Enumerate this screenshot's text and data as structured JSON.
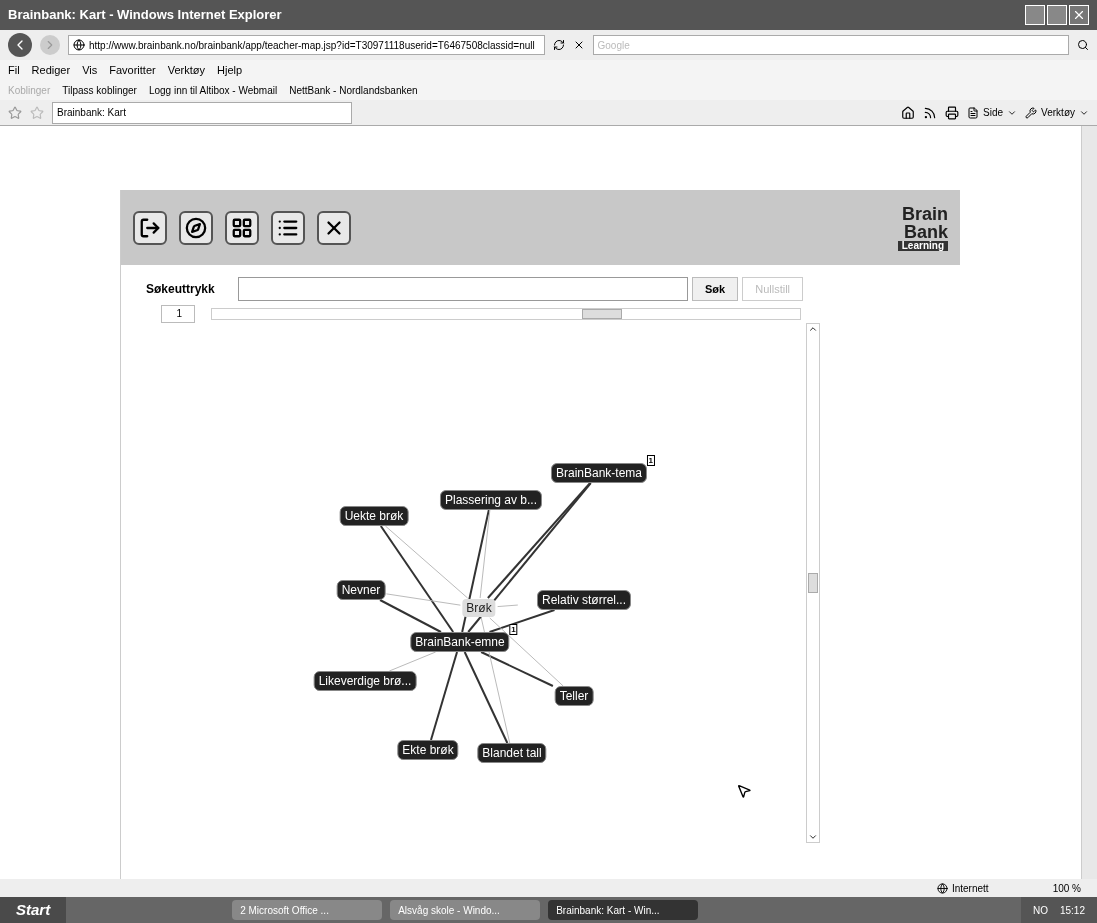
{
  "window": {
    "title": "Brainbank: Kart - Windows Internet Explorer"
  },
  "address_bar": {
    "url": "http://www.brainbank.no/brainbank/app/teacher-map.jsp?id=T30971118userid=T6467508classid=null",
    "search_placeholder": "Google"
  },
  "menu": [
    "Fil",
    "Rediger",
    "Vis",
    "Favoritter",
    "Verktøy",
    "Hjelp"
  ],
  "links_bar": {
    "label": "Koblinger",
    "links": [
      "Tilpass koblinger",
      "Logg inn til Altibox - Webmail",
      "NettBank - Nordlandsbanken"
    ]
  },
  "tab": {
    "title": "Brainbank: Kart"
  },
  "command_bar": [
    "Side",
    "Verktøy"
  ],
  "app": {
    "logo": {
      "line1": "Brain",
      "line2": "Bank",
      "tag": "Learning"
    },
    "search": {
      "label": "Søkeuttrykk",
      "button": "Søk",
      "reset": "Nullstill",
      "reset_disabled": true,
      "depth": "1"
    },
    "map_nodes": [
      {
        "label": "BrainBank-tema",
        "kind": "dark",
        "badge": "1"
      },
      {
        "label": "Plassering av b...",
        "kind": "dark"
      },
      {
        "label": "Uekte brøk",
        "kind": "dark"
      },
      {
        "label": "Nevner",
        "kind": "dark"
      },
      {
        "label": "Brøk",
        "kind": "light"
      },
      {
        "label": "Relativ størrel...",
        "kind": "dark"
      },
      {
        "label": "BrainBank-emne",
        "kind": "dark",
        "badge": "1"
      },
      {
        "label": "Likeverdige brø...",
        "kind": "dark"
      },
      {
        "label": "Teller",
        "kind": "dark"
      },
      {
        "label": "Ekte brøk",
        "kind": "dark"
      },
      {
        "label": "Blandet tall",
        "kind": "dark"
      }
    ]
  },
  "status_bar": {
    "zone": "Internett",
    "zoom": "100 %"
  },
  "taskbar": {
    "start": "Start",
    "tasks": [
      {
        "label": "2 Microsoft Office ...",
        "selected": false
      },
      {
        "label": "Alsvåg skole - Windo...",
        "selected": false
      },
      {
        "label": "Brainbank: Kart - Win...",
        "selected": true
      }
    ],
    "language": "NO",
    "clock": "15:12"
  }
}
